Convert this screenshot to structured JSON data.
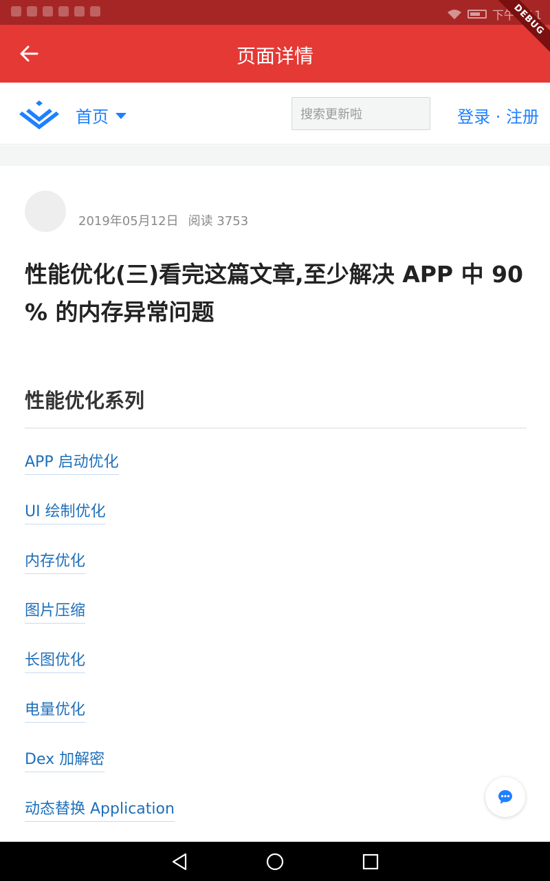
{
  "status_bar": {
    "time": "下午4:11",
    "icons": [
      "usb-icon",
      "usb-icon",
      "notification-icon",
      "notification-icon",
      "notification-icon",
      "notification-icon",
      "wifi-icon",
      "battery-icon"
    ]
  },
  "debug_banner": "DEBUG",
  "app_bar": {
    "back_icon": "arrow-left-icon",
    "title": "页面详情"
  },
  "site_header": {
    "logo_icon": "site-logo-icon",
    "nav_label": "首页",
    "search_placeholder": "搜索更新啦",
    "auth_label": "登录 · 注册"
  },
  "article": {
    "date": "2019年05月12日",
    "reads": "阅读 3753",
    "title": "性能优化(三)看完这篇文章,至少解决 APP 中 90 % 的内存异常问题",
    "section_heading": "性能优化系列",
    "series_links": [
      "APP 启动优化",
      "UI 绘制优化",
      "内存优化",
      "图片压缩",
      "长图优化",
      "电量优化",
      "Dex 加解密",
      "动态替换 Application"
    ]
  },
  "colors": {
    "app_bar": "#e53935",
    "status_bar": "#a62626",
    "link": "#1e6fba",
    "brand_blue": "#1e80ff"
  }
}
